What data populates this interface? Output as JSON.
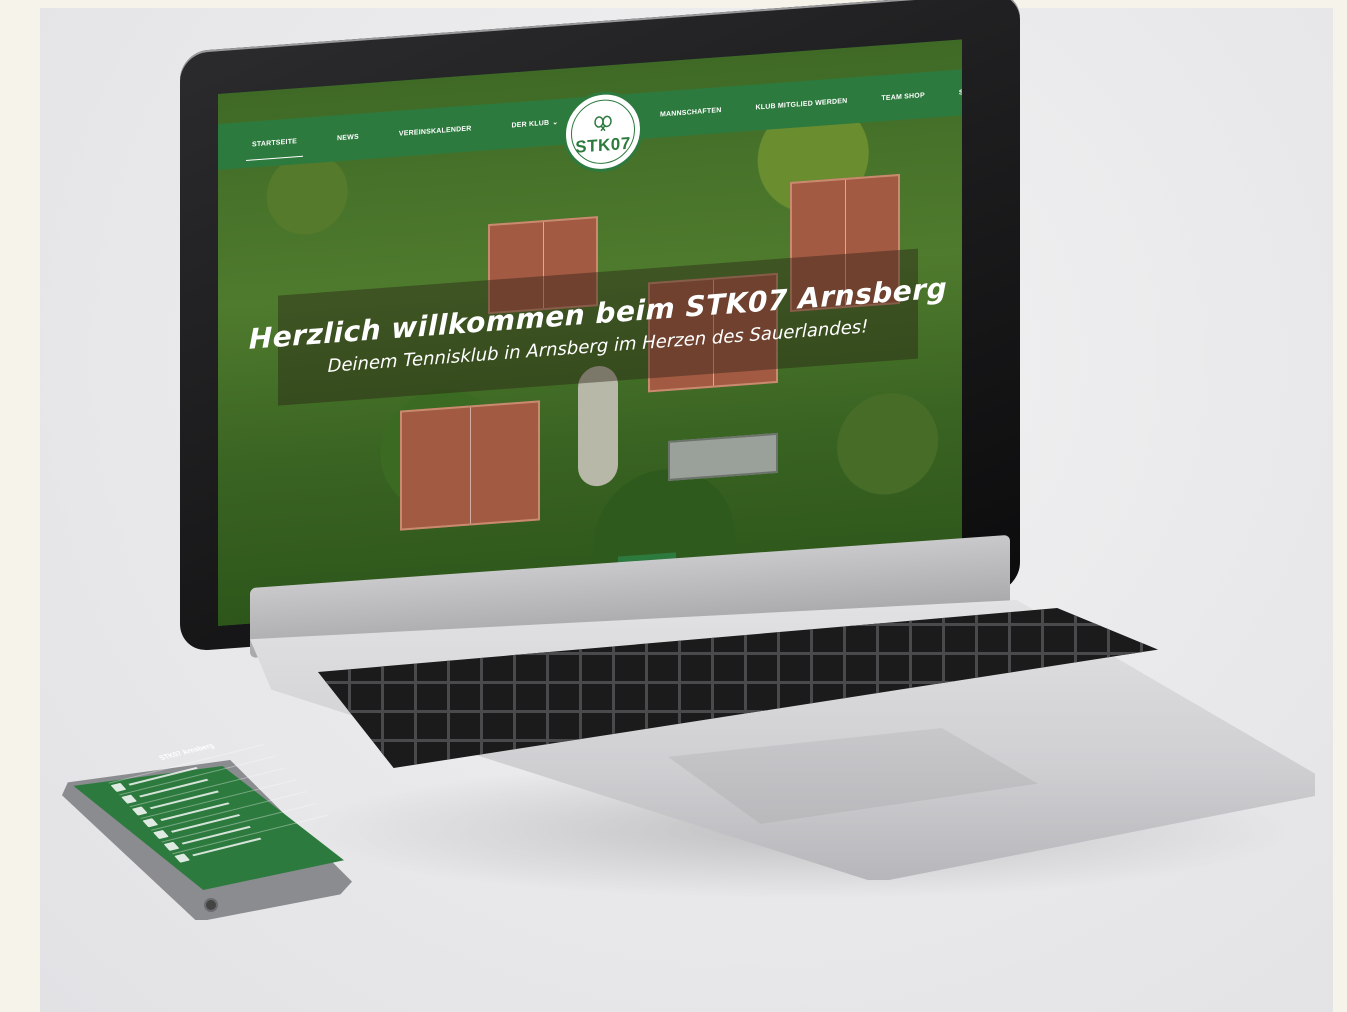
{
  "site": {
    "logo_text": "STK07",
    "nav_left": [
      "STARTSEITE",
      "NEWS",
      "VEREINSKALENDER",
      "DER KLUB"
    ],
    "nav_right": [
      "MANNSCHAFTEN",
      "KLUB MITGLIED WERDEN",
      "TEAM SHOP",
      "SPONSOREN"
    ],
    "active_item": "STARTSEITE"
  },
  "hero": {
    "title": "Herzlich willkommen beim STK07 Arnsberg",
    "subtitle": "Deinem Tennisklub in Arnsberg im Herzen des Sauerlandes!"
  },
  "phone": {
    "app_title": "STK07 Arnsberg"
  },
  "colors": {
    "brand_green": "#2d7a3e",
    "clay": "#a35a42",
    "background": "#f6f3ea"
  },
  "icons": {
    "scroll_down": "chevron-down-icon",
    "dropdown": "chevron-down-icon",
    "logo_mark": "tennis-rackets-icon"
  }
}
